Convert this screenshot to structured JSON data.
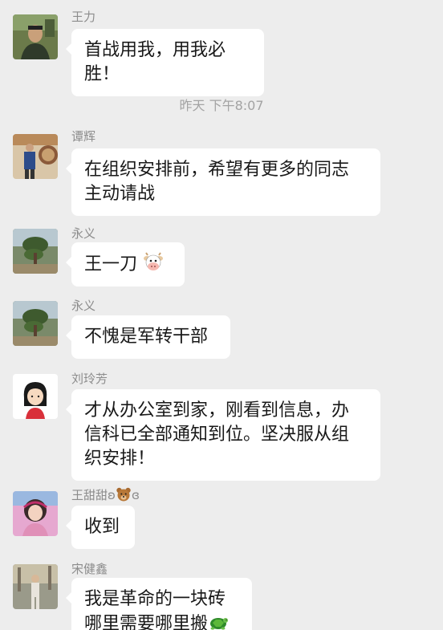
{
  "messages": [
    {
      "sender": "王力",
      "lines": [
        "首战用我，用我必胜！"
      ]
    },
    {
      "sender": "谭辉",
      "lines": [
        "在组织安排前，希望有更多的同志",
        "主动请战"
      ]
    },
    {
      "sender": "永义",
      "lines": [
        "王一刀"
      ],
      "emoji": "cow-face-icon"
    },
    {
      "sender": "永义",
      "lines": [
        "不愧是军转干部"
      ]
    },
    {
      "sender": "刘玲芳",
      "lines": [
        "才从办公室到家，刚看到信息，办",
        "信科已全部通知到位。坚决服从组",
        "织安排！"
      ]
    },
    {
      "sender_prefix": "王甜甜",
      "sender_deco_left": "ʚ",
      "sender_deco_right": "ɞ",
      "sender_emoji": "bear-face-icon",
      "lines": [
        "收到"
      ]
    },
    {
      "sender": "宋健鑫",
      "lines": [
        "我是革命的一块砖",
        "哪里需要哪里搬"
      ],
      "emoji": "turtle-icon"
    }
  ],
  "timestamp": "昨天 下午8:07",
  "colors": {
    "background": "#ededed",
    "bubble": "#ffffff",
    "sender_text": "#8c8c8c",
    "message_text": "#191919",
    "timestamp_text": "#a3a3a3"
  }
}
